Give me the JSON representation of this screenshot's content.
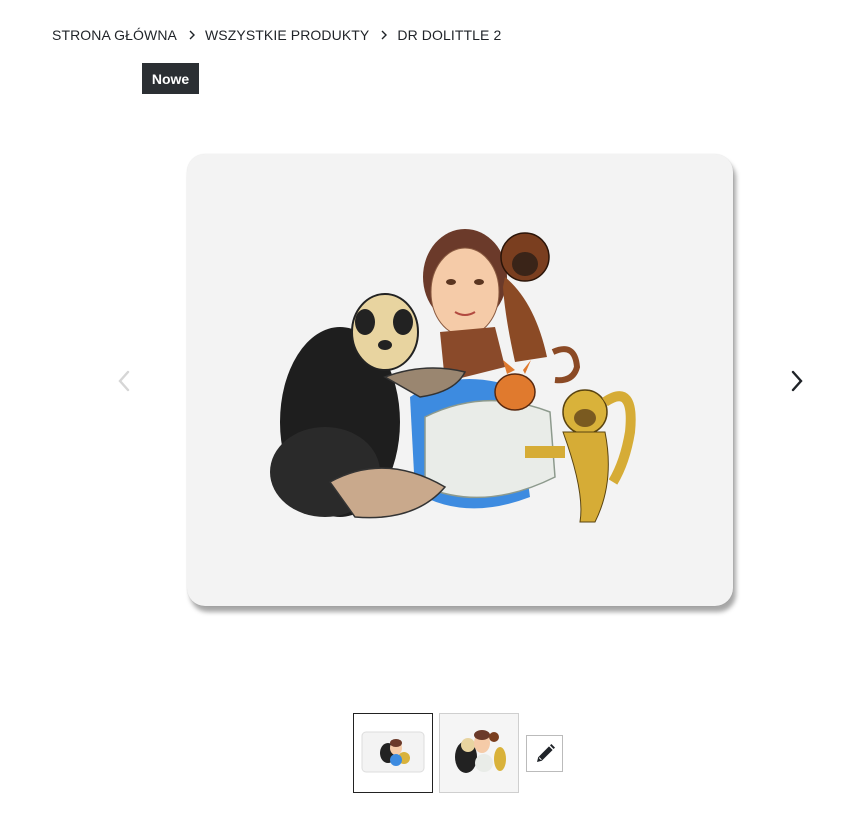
{
  "breadcrumb": {
    "items": [
      "STRONA GŁÓWNA",
      "WSZYSTKIE PRODUKTY",
      "DR DOLITTLE 2"
    ]
  },
  "badge": {
    "label": "Nowe"
  },
  "gallery": {
    "prev_icon": "chevron-left-icon",
    "next_icon": "chevron-right-icon",
    "main_image": "mouse-pad-with-woman-and-animals-illustration",
    "thumbnails": [
      {
        "name": "thumbnail-mouse-pad",
        "selected": true
      },
      {
        "name": "thumbnail-design",
        "selected": false
      }
    ],
    "edit_icon": "pencil-icon"
  },
  "colors": {
    "text": "#1f2328",
    "badge_bg": "#2b2f33",
    "badge_text": "#ffffff",
    "pad": "#f3f3f3",
    "arrow_inactive": "#d6d6d6",
    "arrow_active": "#1f2328"
  }
}
